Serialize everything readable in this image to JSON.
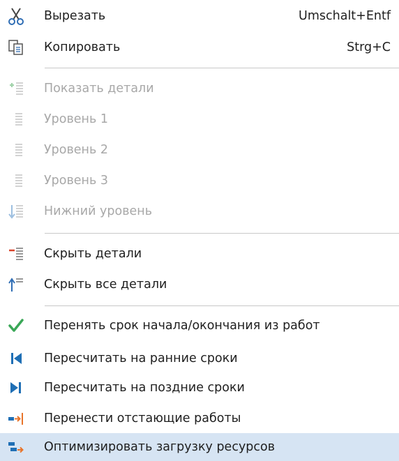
{
  "menu": {
    "cut": {
      "label": "Вырезать",
      "shortcut": "Umschalt+Entf"
    },
    "copy": {
      "label": "Копировать",
      "shortcut": "Strg+C"
    },
    "show_details": {
      "label": "Показать детали"
    },
    "level_1": {
      "label": "Уровень 1"
    },
    "level_2": {
      "label": "Уровень 2"
    },
    "level_3": {
      "label": "Уровень 3"
    },
    "bottom_level": {
      "label": "Нижний уровень"
    },
    "hide_details": {
      "label": "Скрыть детали"
    },
    "hide_all_details": {
      "label": "Скрыть все детали"
    },
    "adopt_dates": {
      "label": "Перенять срок начала/окончания из работ"
    },
    "recalc_early": {
      "label": "Пересчитать на ранние сроки"
    },
    "recalc_late": {
      "label": "Пересчитать на поздние сроки"
    },
    "move_lagging": {
      "label": "Перенести отстающие работы"
    },
    "optimize_resources": {
      "label": "Оптимизировать загрузку ресурсов"
    }
  },
  "colors": {
    "highlight": "#d6e4f3",
    "check_green": "#3aa757",
    "accent_blue": "#1f6fb5",
    "accent_orange": "#e8742a",
    "disabled_text": "#a8a8a8"
  }
}
